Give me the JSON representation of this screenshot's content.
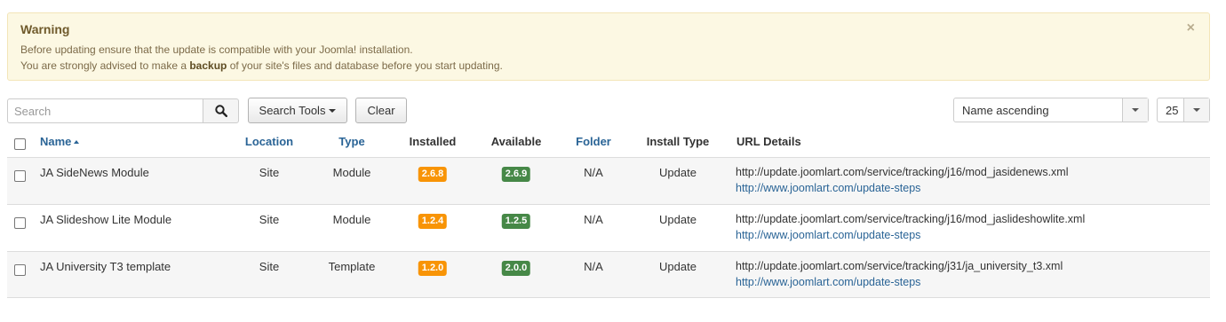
{
  "alert": {
    "heading": "Warning",
    "line1": "Before updating ensure that the update is compatible with your Joomla! installation.",
    "line2_pre": "You are strongly advised to make a ",
    "line2_bold": "backup",
    "line2_post": " of your site's files and database before you start updating.",
    "close": "×"
  },
  "toolbar": {
    "search_placeholder": "Search",
    "search_tools_label": "Search Tools",
    "clear_label": "Clear",
    "ordering_value": "Name ascending",
    "limit_value": "25"
  },
  "table": {
    "headers": {
      "name": "Name",
      "location": "Location",
      "type": "Type",
      "installed": "Installed",
      "available": "Available",
      "folder": "Folder",
      "install_type": "Install Type",
      "url_details": "URL Details"
    },
    "rows": [
      {
        "name": "JA SideNews Module",
        "location": "Site",
        "type": "Module",
        "installed": "2.6.8",
        "available": "2.6.9",
        "folder": "N/A",
        "install_type": "Update",
        "url": "http://update.joomlart.com/service/tracking/j16/mod_jasidenews.xml",
        "info_url": "http://www.joomlart.com/update-steps"
      },
      {
        "name": "JA Slideshow Lite Module",
        "location": "Site",
        "type": "Module",
        "installed": "1.2.4",
        "available": "1.2.5",
        "folder": "N/A",
        "install_type": "Update",
        "url": "http://update.joomlart.com/service/tracking/j16/mod_jaslideshowlite.xml",
        "info_url": "http://www.joomlart.com/update-steps"
      },
      {
        "name": "JA University T3 template",
        "location": "Site",
        "type": "Template",
        "installed": "1.2.0",
        "available": "2.0.0",
        "folder": "N/A",
        "install_type": "Update",
        "url": "http://update.joomlart.com/service/tracking/j31/ja_university_t3.xml",
        "info_url": "http://www.joomlart.com/update-steps"
      }
    ]
  },
  "colors": {
    "installed_badge": "#f89406",
    "available_badge": "#468847",
    "link": "#2a6496",
    "alert_bg": "#fcf8e3"
  }
}
